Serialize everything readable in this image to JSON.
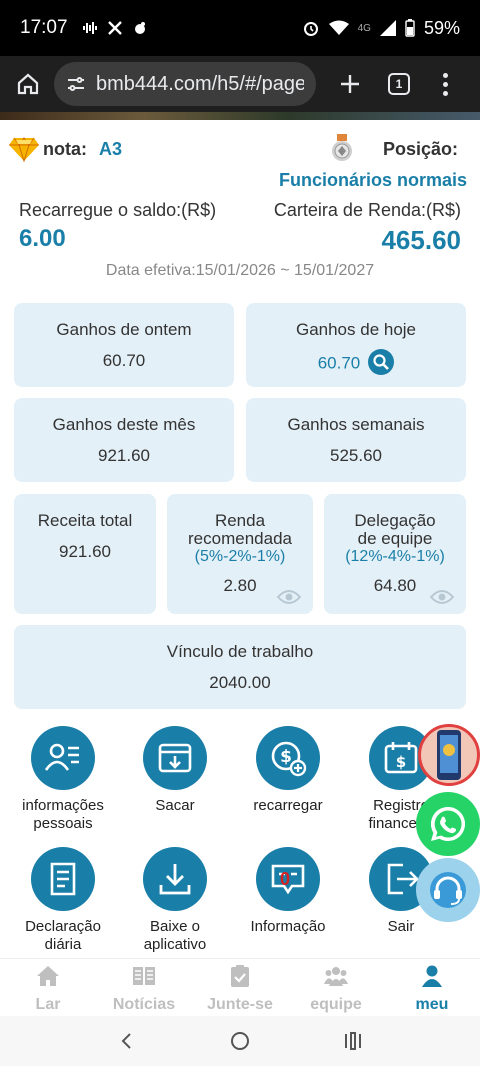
{
  "status_bar": {
    "time": "17:07",
    "network": "4G",
    "battery": "59%"
  },
  "browser": {
    "url": "bmb444.com/h5/#/pages",
    "tab_count": "1"
  },
  "profile": {
    "nota_label": "nota:",
    "grade": "A3",
    "position_label": "Posição:",
    "position_value": "Funcionários normais"
  },
  "balances": {
    "recharge_label": "Recarregue o saldo:(R$)",
    "recharge_value": "6.00",
    "income_label": "Carteira de Renda:(R$)",
    "income_value": "465.60"
  },
  "effective_date": "Data efetiva:15/01/2026 ~ 15/01/2027",
  "stats": {
    "yesterday": {
      "label": "Ganhos de ontem",
      "value": "60.70"
    },
    "today": {
      "label": "Ganhos de hoje",
      "value": "60.70"
    },
    "month": {
      "label": "Ganhos deste mês",
      "value": "921.60"
    },
    "week": {
      "label": "Ganhos semanais",
      "value": "525.60"
    },
    "total": {
      "label": "Receita total",
      "value": "921.60"
    },
    "recommended": {
      "label_1": "Renda",
      "label_2": "recomendada",
      "sub": "(5%-2%-1%)",
      "value": "2.80"
    },
    "delegation": {
      "label_1": "Delegação",
      "label_2": "de equipe",
      "sub": "(12%-4%-1%)",
      "value": "64.80"
    },
    "contract": {
      "label": "Vínculo de trabalho",
      "value": "2040.00"
    }
  },
  "grid": {
    "personal": {
      "l1": "informações",
      "l2": "pessoais"
    },
    "withdraw": {
      "l1": "Sacar"
    },
    "recharge": {
      "l1": "recarregar"
    },
    "records": {
      "l1": "Registro",
      "l2": "financeiro"
    },
    "declaration": {
      "l1": "Declaração",
      "l2": "diária"
    },
    "download": {
      "l1": "Baixe o",
      "l2": "aplicativo"
    },
    "info": {
      "l1": "Informação",
      "badge": "0"
    },
    "logout": {
      "l1": "Sair"
    }
  },
  "tabs": {
    "home": "Lar",
    "news": "Notícias",
    "join": "Junte-se",
    "team": "equipe",
    "me": "meu"
  },
  "colors": {
    "accent": "#1a7fa8",
    "card_bg": "#e4f0f7",
    "inactive_tab": "#bfbfbf"
  }
}
